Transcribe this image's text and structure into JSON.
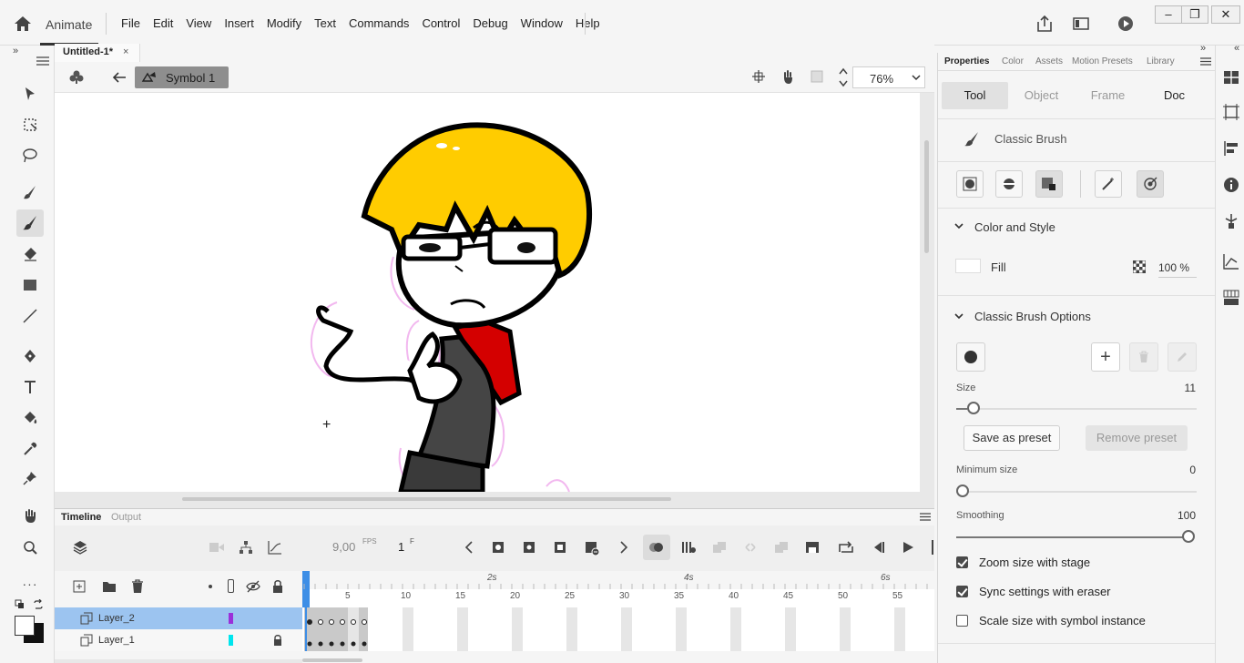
{
  "app": {
    "name": "Animate"
  },
  "menu": [
    "File",
    "Edit",
    "View",
    "Insert",
    "Modify",
    "Text",
    "Commands",
    "Control",
    "Debug",
    "Window",
    "Help"
  ],
  "document": {
    "tab_title": "Untitled-1*",
    "close": "×"
  },
  "stage": {
    "symbol_label": "Symbol 1",
    "zoom": "76%"
  },
  "timeline": {
    "tabs": [
      "Timeline",
      "Output"
    ],
    "fps": "9,00",
    "fps_unit": "FPS",
    "frame": "1",
    "frame_unit": "F",
    "ruler_seconds": [
      "2s",
      "4s",
      "6s"
    ],
    "ruler_frames": [
      "5",
      "10",
      "15",
      "20",
      "25",
      "30",
      "35",
      "40",
      "45",
      "50",
      "55"
    ],
    "layers": [
      {
        "name": "Layer_2",
        "color": "#9b30d9",
        "selected": true
      },
      {
        "name": "Layer_1",
        "color": "#00e5ee",
        "selected": false
      }
    ]
  },
  "properties": {
    "tabs": [
      "Properties",
      "Color",
      "Assets",
      "Motion Presets",
      "Library"
    ],
    "subtabs": [
      "Tool",
      "Object",
      "Frame",
      "Doc"
    ],
    "tool_name": "Classic Brush",
    "color_style_title": "Color and Style",
    "fill_label": "Fill",
    "fill_alpha": "100 %",
    "brush_options_title": "Classic Brush Options",
    "size_label": "Size",
    "size_value": "11",
    "save_preset": "Save as preset",
    "remove_preset": "Remove preset",
    "min_size_label": "Minimum size",
    "min_size_value": "0",
    "smoothing_label": "Smoothing",
    "smoothing_value": "100",
    "checkboxes": [
      {
        "label": "Zoom size with stage",
        "checked": true
      },
      {
        "label": "Sync settings with eraser",
        "checked": true
      },
      {
        "label": "Scale size with symbol instance",
        "checked": false
      }
    ]
  },
  "colors": {
    "accent_selection": "#9cc4f0",
    "hair": "#ffcc00",
    "shirt": "#d40000"
  }
}
